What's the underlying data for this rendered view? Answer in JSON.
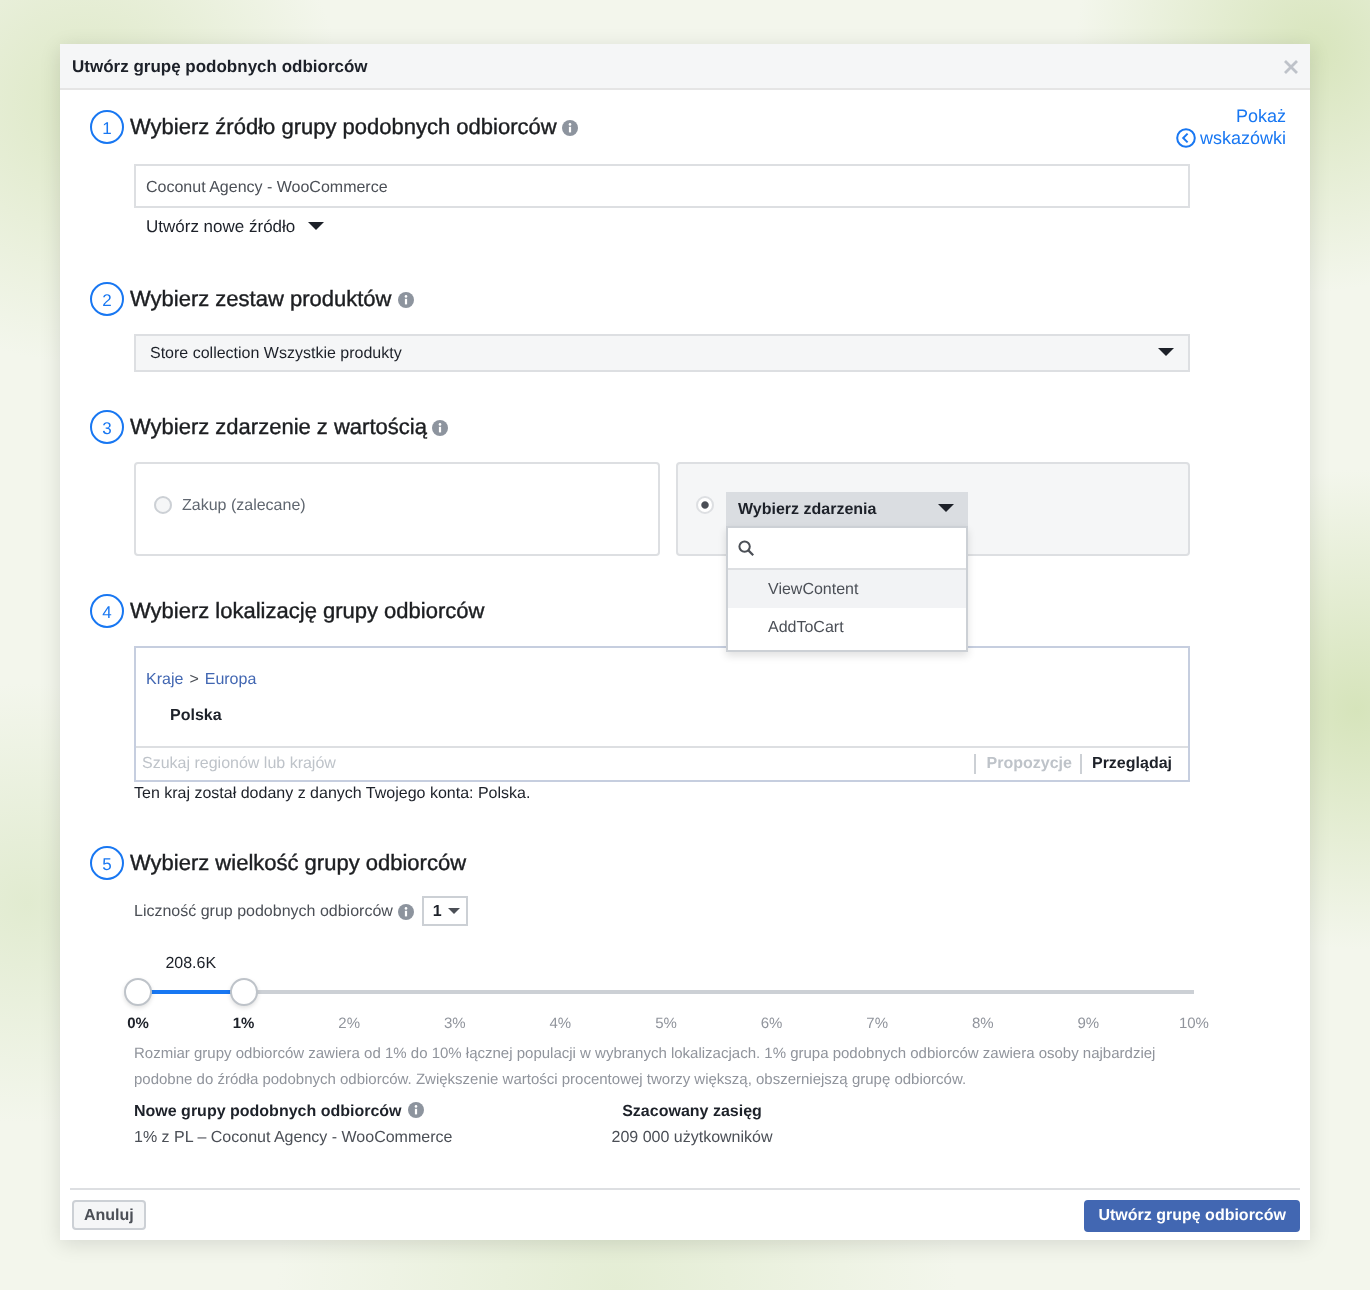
{
  "dialog": {
    "title": "Utwórz grupę podobnych odbiorców"
  },
  "hint_link": {
    "label": "Pokaż wskazówki"
  },
  "steps": [
    {
      "kind": "source",
      "number": "1",
      "title": "Wybierz źródło grupy podobnych odbiorców",
      "info": true,
      "source_value": "Coconut Agency - WooCommerce",
      "create_source": "Utwórz nowe źródło"
    },
    {
      "kind": "product_set",
      "number": "2",
      "title": "Wybierz zestaw produktów",
      "info": true,
      "selected_set": "Store collection Wszystkie produkty"
    },
    {
      "kind": "event",
      "number": "3",
      "title": "Wybierz zdarzenie z wartością",
      "info": true,
      "options": [
        {
          "kind": "label",
          "label": "Zakup (zalecane)",
          "selected": false
        },
        {
          "kind": "dropdown",
          "label": "Wybierz zdarzenia",
          "selected": true,
          "expanded": true,
          "items": [
            {
              "label": "ViewContent",
              "highlighted": true
            },
            {
              "label": "AddToCart",
              "highlighted": false
            }
          ]
        }
      ]
    },
    {
      "kind": "location",
      "number": "4",
      "title": "Wybierz lokalizację grupy odbiorców",
      "info": false,
      "breadcrumb": [
        "Kraje",
        "Europa"
      ],
      "breadcrumb_separator": ">",
      "selected_location": "Polska",
      "search_placeholder": "Szukaj regionów lub krajów",
      "view_tabs": [
        {
          "label": "Propozycje",
          "selected": false
        },
        {
          "label": "Przeglądaj",
          "selected": true
        }
      ],
      "note": "Ten kraj został dodany z danych Twojego konta: Polska."
    },
    {
      "kind": "size",
      "number": "5",
      "title": "Wybierz wielkość grupy odbiorców",
      "info": false,
      "count_label": "Liczność grup podobnych odbiorców",
      "count_info": true,
      "count_value": "1",
      "slider": {
        "reach": "208.6K",
        "level": 0.1,
        "ticks": [
          "0%",
          "1%",
          "2%",
          "3%",
          "4%",
          "5%",
          "6%",
          "7%",
          "8%",
          "9%",
          "10%"
        ]
      },
      "description": "Rozmiar grupy odbiorców zawiera od 1% do 10% łącznej populacji w wybranych lokalizacjach. 1% grupa podobnych odbiorców zawiera osoby najbardziej podobne do źródła podobnych odbiorców. Zwiększenie wartości procentowej tworzy większą, obszerniejszą grupę odbiorców.",
      "summary": [
        {
          "heading": "Nowe grupy podobnych odbiorców",
          "info": true,
          "value": "1% z PL – Coconut Agency - WooCommerce"
        },
        {
          "heading": "Szacowany zasięg",
          "info": false,
          "value": "209 000 użytkowników"
        }
      ]
    }
  ],
  "footer": {
    "cancel": "Anuluj",
    "submit": "Utwórz grupę odbiorców"
  }
}
